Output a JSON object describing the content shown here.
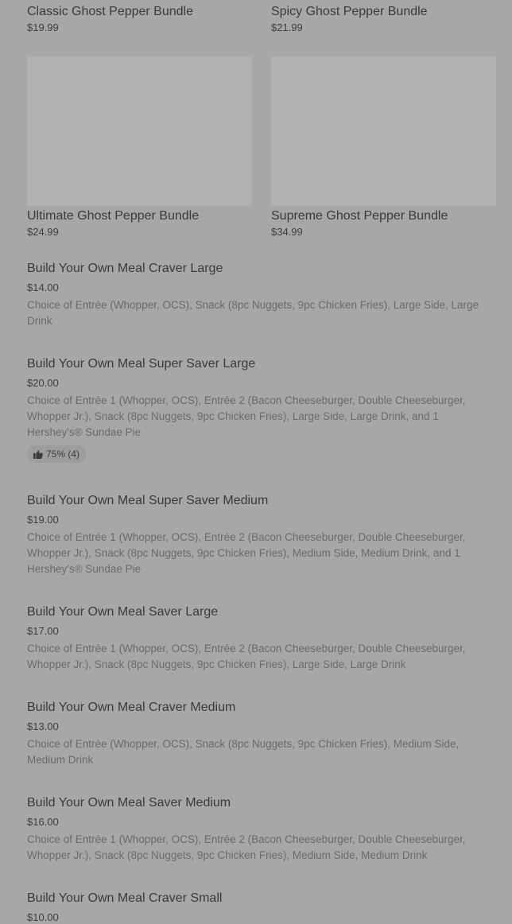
{
  "bundles": [
    {
      "name": "Classic Ghost Pepper Bundle",
      "price": "$19.99"
    },
    {
      "name": "Spicy Ghost Pepper Bundle",
      "price": "$21.99"
    },
    {
      "name": "Ultimate Ghost Pepper Bundle",
      "price": "$24.99"
    },
    {
      "name": "Supreme Ghost Pepper Bundle",
      "price": "$34.99"
    }
  ],
  "menu_items": [
    {
      "name": "Build Your Own Meal Craver Large",
      "price": "$14.00",
      "description": "Choice of Entrée (Whopper, OCS), Snack (8pc Nuggets, 9pc Chicken Fries), Large Side, Large Drink"
    },
    {
      "name": "Build Your Own Meal Super Saver Large",
      "price": "$20.00",
      "description": "Choice of Entrée 1 (Whopper, OCS), Entrée 2 (Bacon Cheeseburger, Double Cheeseburger, Whopper Jr.), Snack (8pc Nuggets, 9pc Chicken Fries), Large Side, Large Drink, and 1 Hershey's® Sundae Pie",
      "rating": "75% (4)"
    },
    {
      "name": "Build Your Own Meal Super Saver Medium",
      "price": "$19.00",
      "description": "Choice of Entrée 1 (Whopper, OCS), Entrée 2 (Bacon Cheeseburger, Double Cheeseburger, Whopper Jr.), Snack (8pc Nuggets, 9pc Chicken Fries), Medium Side, Medium Drink, and 1 Hershey's® Sundae Pie"
    },
    {
      "name": "Build Your Own Meal Saver Large",
      "price": "$17.00",
      "description": "Choice of Entrée 1 (Whopper, OCS), Entrée 2 (Bacon Cheeseburger, Double Cheeseburger, Whopper Jr.), Snack (8pc Nuggets, 9pc Chicken Fries), Large Side, Large Drink"
    },
    {
      "name": "Build Your Own Meal Craver Medium",
      "price": "$13.00",
      "description": "Choice of Entrée (Whopper, OCS), Snack (8pc Nuggets, 9pc Chicken Fries), Medium Side, Medium Drink"
    },
    {
      "name": "Build Your Own Meal Saver Medium",
      "price": "$16.00",
      "description": "Choice of Entrée 1 (Whopper, OCS), Entrée 2 (Bacon Cheeseburger, Double Cheeseburger, Whopper Jr.), Snack (8pc Nuggets, 9pc Chicken Fries), Medium Side, Medium Drink"
    },
    {
      "name": "Build Your Own Meal Craver Small",
      "price": "$10.00"
    }
  ],
  "icons": {
    "rating": "thumbs-up-icon"
  },
  "colors": {
    "overlay_background": "#a7a7a7",
    "image_placeholder": "#b1b1b1"
  }
}
